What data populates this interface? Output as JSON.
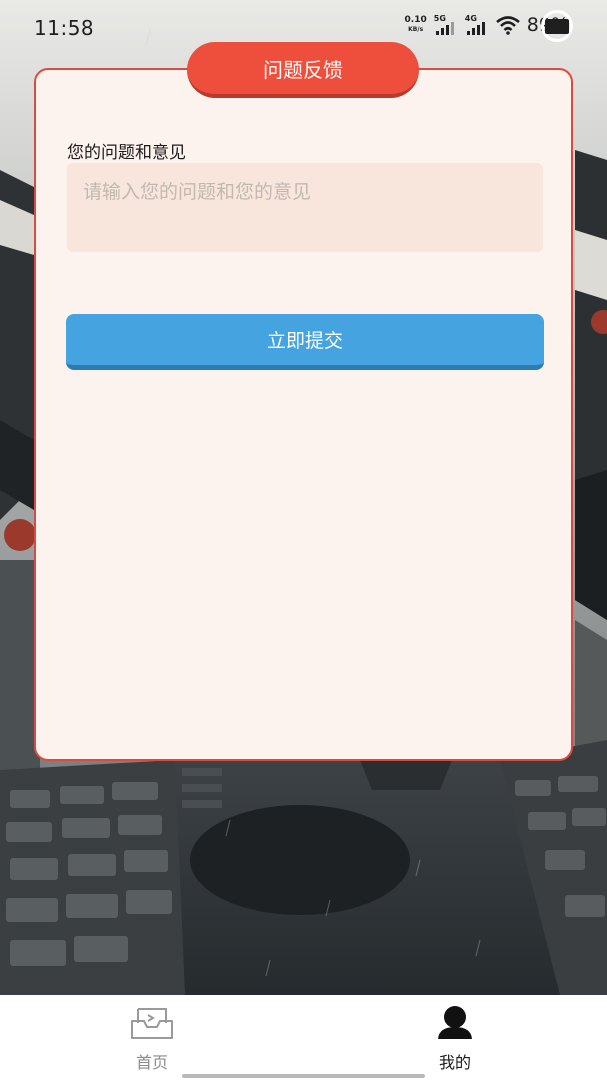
{
  "status_bar": {
    "time": "11:58",
    "net_speed_value": "0.10",
    "net_speed_unit": "KB/s",
    "sim1_type": "5G",
    "sim2_type": "4G",
    "battery": "89%"
  },
  "feedback": {
    "title": "问题反馈",
    "field_label": "您的问题和意见",
    "input_placeholder": "请输入您的问题和您的意见",
    "input_value": "",
    "submit_label": "立即提交"
  },
  "tab_bar": {
    "tabs": [
      {
        "label": "首页",
        "icon": "home-tray-icon",
        "active": false
      },
      {
        "label": "我的",
        "icon": "person-icon",
        "active": true
      }
    ]
  },
  "colors": {
    "title_pill": "#ee4f3d",
    "card_border": "#d94b40",
    "card_bg": "#fdf3ee",
    "input_bg": "#f8e6dc",
    "submit_button": "#45a4e0"
  }
}
